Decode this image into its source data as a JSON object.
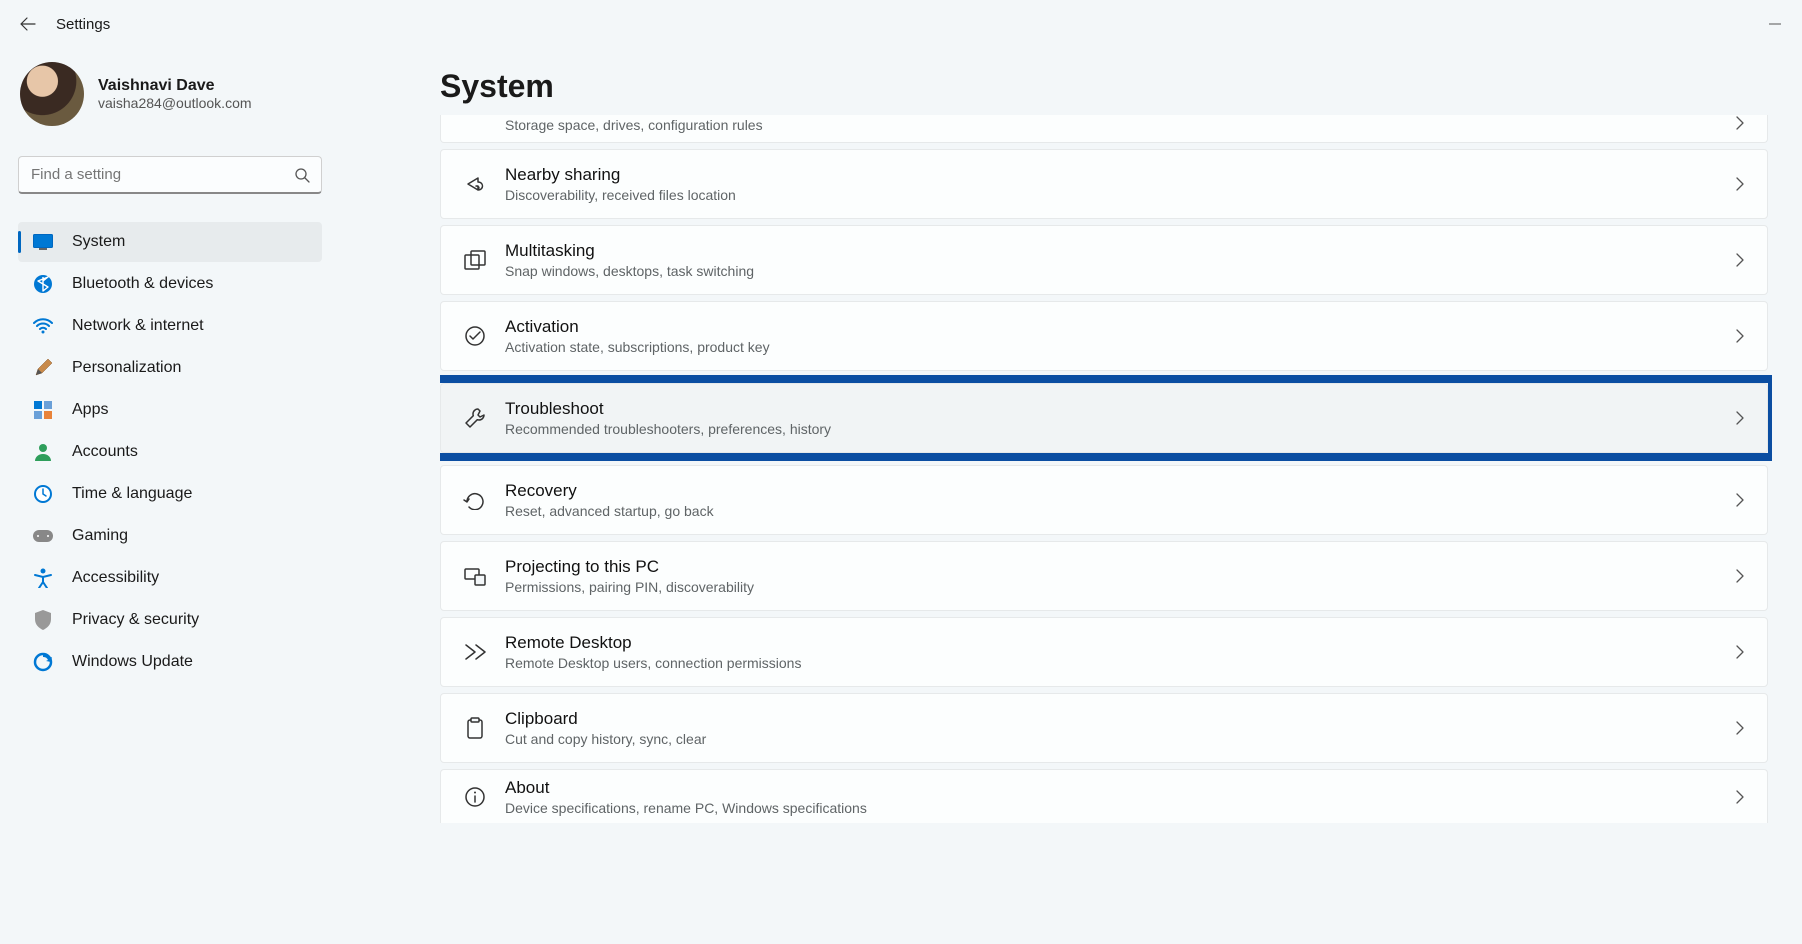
{
  "titlebar": {
    "title": "Settings"
  },
  "profile": {
    "name": "Vaishnavi Dave",
    "email": "vaisha284@outlook.com"
  },
  "search": {
    "placeholder": "Find a setting"
  },
  "nav": {
    "items": [
      {
        "label": "System"
      },
      {
        "label": "Bluetooth & devices"
      },
      {
        "label": "Network & internet"
      },
      {
        "label": "Personalization"
      },
      {
        "label": "Apps"
      },
      {
        "label": "Accounts"
      },
      {
        "label": "Time & language"
      },
      {
        "label": "Gaming"
      },
      {
        "label": "Accessibility"
      },
      {
        "label": "Privacy & security"
      },
      {
        "label": "Windows Update"
      }
    ]
  },
  "main": {
    "heading": "System",
    "items": [
      {
        "title": "",
        "desc": "Storage space, drives, configuration rules"
      },
      {
        "title": "Nearby sharing",
        "desc": "Discoverability, received files location"
      },
      {
        "title": "Multitasking",
        "desc": "Snap windows, desktops, task switching"
      },
      {
        "title": "Activation",
        "desc": "Activation state, subscriptions, product key"
      },
      {
        "title": "Troubleshoot",
        "desc": "Recommended troubleshooters, preferences, history"
      },
      {
        "title": "Recovery",
        "desc": "Reset, advanced startup, go back"
      },
      {
        "title": "Projecting to this PC",
        "desc": "Permissions, pairing PIN, discoverability"
      },
      {
        "title": "Remote Desktop",
        "desc": "Remote Desktop users, connection permissions"
      },
      {
        "title": "Clipboard",
        "desc": "Cut and copy history, sync, clear"
      },
      {
        "title": "About",
        "desc": "Device specifications, rename PC, Windows specifications"
      }
    ]
  },
  "highlight_color": "#0b4ea2"
}
